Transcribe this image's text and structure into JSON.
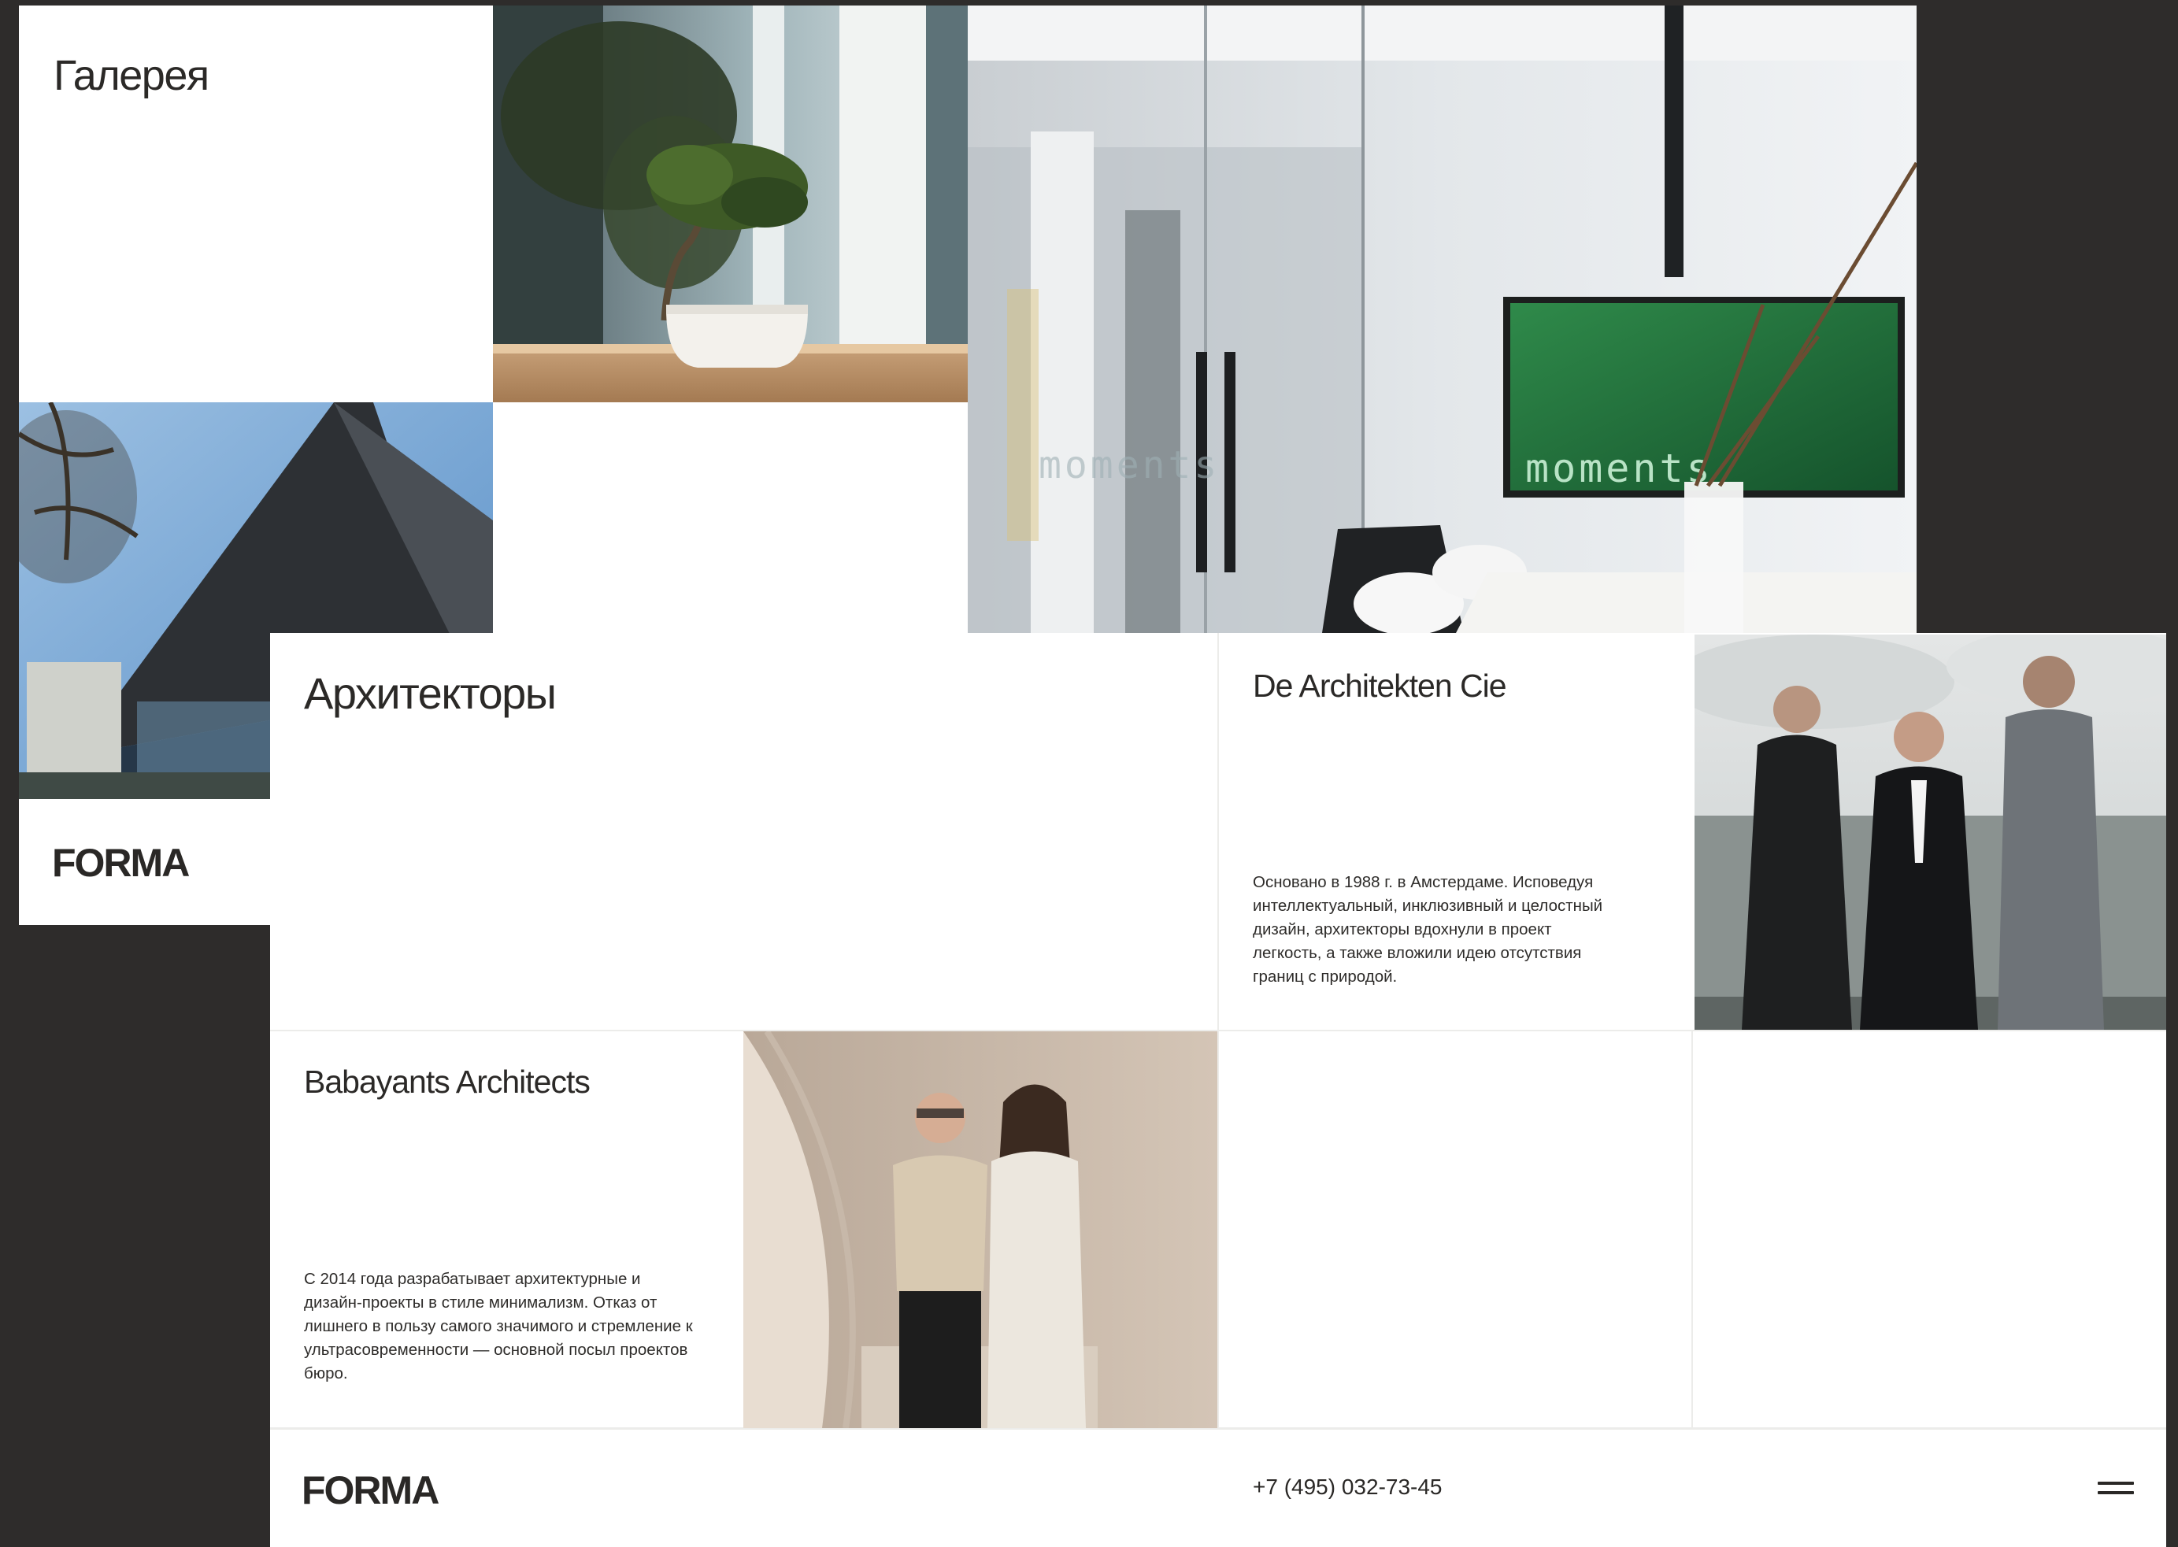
{
  "gallery_slide": {
    "title": "Галерея",
    "logo": "FORMA",
    "photos": {
      "bonsai": "bonsai-tree-photo",
      "building": "glass-building-photo",
      "meeting_room": "meeting-room-photo",
      "screen_text": "moments",
      "glass_text": "moments"
    }
  },
  "architects_slide": {
    "title": "Архитекторы",
    "studios": [
      {
        "name": "De Architekten Cie",
        "description": "Основано в 1988 г. в Амстердаме. Исповедуя интеллектуальный, инклюзивный и целостный дизайн, архитекторы вдохнули в проект легкость,  а также вложили идею отсутствия границ с природой."
      },
      {
        "name": "Babayants Architects",
        "description": "С 2014 года разрабатывает архитектурные и дизайн-проекты в стиле минимализм. Отказ от лишнего в пользу самого значимого и стремление к ультрасовременности — основной посыл проектов бюро."
      }
    ],
    "footer": {
      "logo": "FORMA",
      "phone": "+7 (495) 032-73-45",
      "menu_icon": "hamburger-menu-icon"
    }
  },
  "colors": {
    "background": "#2e2c2b",
    "slide": "#ffffff",
    "text": "#2a2826",
    "divider": "#ececea",
    "screen_green": "#1e6b3c"
  }
}
